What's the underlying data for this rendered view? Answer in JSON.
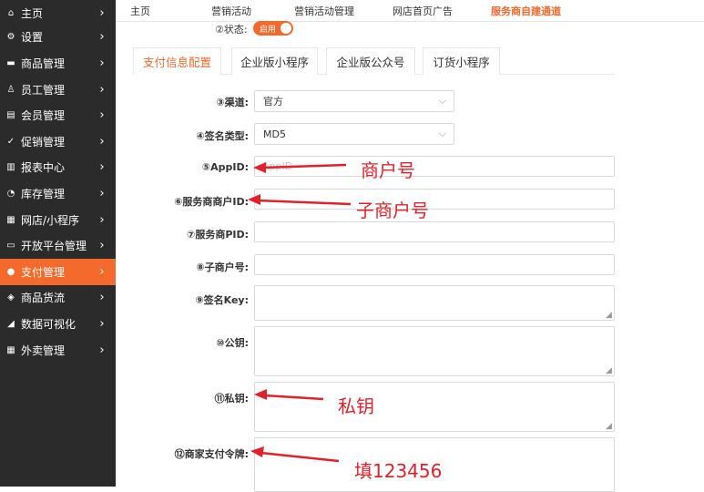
{
  "sidebar": {
    "items": [
      {
        "icon": "home-icon",
        "glyph": "⌂",
        "label": "主页"
      },
      {
        "icon": "gear-icon",
        "glyph": "⚙",
        "label": "设置"
      },
      {
        "icon": "product-icon",
        "glyph": "▬",
        "label": "商品管理"
      },
      {
        "icon": "staff-icon",
        "glyph": "♙",
        "label": "员工管理"
      },
      {
        "icon": "member-icon",
        "glyph": "▤",
        "label": "会员管理"
      },
      {
        "icon": "promotion-icon",
        "glyph": "✓",
        "label": "促销管理"
      },
      {
        "icon": "report-icon",
        "glyph": "▥",
        "label": "报表中心"
      },
      {
        "icon": "inventory-icon",
        "glyph": "◔",
        "label": "库存管理"
      },
      {
        "icon": "store-icon",
        "glyph": "▦",
        "label": "网店/小程序"
      },
      {
        "icon": "platform-icon",
        "glyph": "▭",
        "label": "开放平台管理"
      },
      {
        "icon": "payment-icon",
        "glyph": "●",
        "label": "支付管理",
        "active": true
      },
      {
        "icon": "goods-flow-icon",
        "glyph": "◈",
        "label": "商品货流"
      },
      {
        "icon": "data-visual-icon",
        "glyph": "◢",
        "label": "数据可视化"
      },
      {
        "icon": "takeout-icon",
        "glyph": "▦",
        "label": "外卖管理"
      }
    ]
  },
  "top_tabs": [
    "主页",
    "营销活动",
    "营销活动管理",
    "网店首页广告",
    "服务商自建通道"
  ],
  "status": {
    "label": "②状态:",
    "toggle_text": "启用"
  },
  "content_tabs": [
    "支付信息配置",
    "企业版小程序",
    "企业版公众号",
    "订货小程序"
  ],
  "form": {
    "channel": {
      "label": "③渠道:",
      "value": "官方"
    },
    "sign_type": {
      "label": "④签名类型:",
      "value": "MD5"
    },
    "appid": {
      "label": "⑤AppID:",
      "placeholder": "AppID"
    },
    "sp_mch_id": {
      "label": "⑥服务商商户ID:"
    },
    "sp_pid": {
      "label": "⑦服务商PID:"
    },
    "sub_mch": {
      "label": "⑧子商户号:"
    },
    "sign_key": {
      "label": "⑨签名Key:"
    },
    "public_key": {
      "label": "⑩公钥:"
    },
    "private_key": {
      "label": "⑪私钥:"
    },
    "merchant_token": {
      "label": "⑫商家支付令牌:"
    }
  },
  "annotations": {
    "note_appid": "商户号",
    "note_sub": "子商户号",
    "note_private": "私钥",
    "note_token": "填123456",
    "color": "#e4212a"
  },
  "colors": {
    "accent": "#f36a2c",
    "sidebar": "#2b2b2b"
  }
}
